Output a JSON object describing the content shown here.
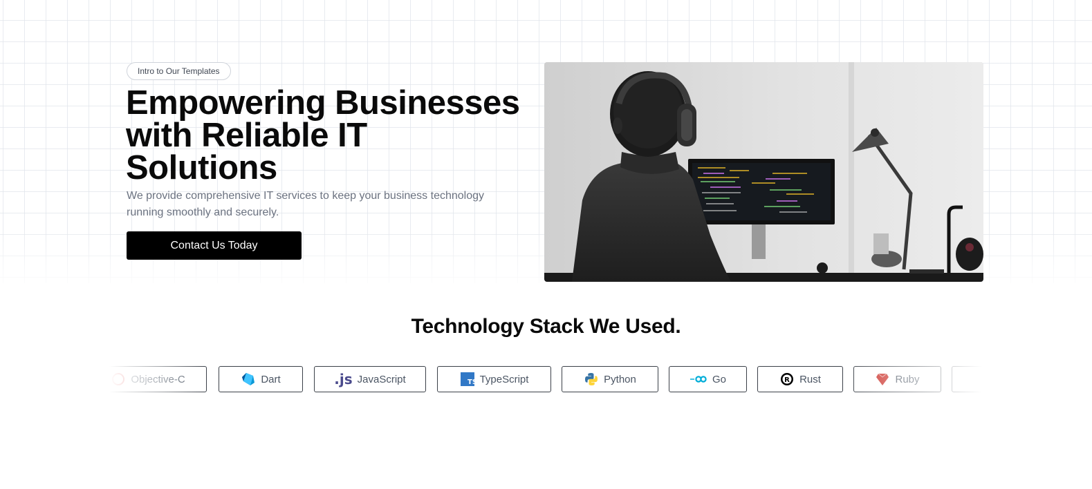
{
  "hero": {
    "badge": "Intro to Our Templates",
    "headline_lines": [
      "Empowering Businesses",
      "with Reliable IT",
      "Solutions"
    ],
    "subtext": "We provide comprehensive IT services to keep your business technology running smoothly and securely.",
    "cta_label": "Contact Us Today"
  },
  "tech": {
    "title": "Technology Stack We Used.",
    "items": [
      {
        "label": "Objective-C",
        "icon": "objective-c-icon"
      },
      {
        "label": "Dart",
        "icon": "dart-icon"
      },
      {
        "label": "JavaScript",
        "icon": "javascript-icon"
      },
      {
        "label": "TypeScript",
        "icon": "typescript-icon"
      },
      {
        "label": "Python",
        "icon": "python-icon"
      },
      {
        "label": "Go",
        "icon": "go-icon"
      },
      {
        "label": "Rust",
        "icon": "rust-icon"
      },
      {
        "label": "Ruby",
        "icon": "ruby-icon"
      }
    ]
  },
  "colors": {
    "primary": "#000000",
    "text": "#0a0a0a",
    "muted": "#6b7280",
    "dart": "#0c99d6",
    "javascript": "#323330",
    "typescript": "#3178c6",
    "go": "#00add8",
    "ruby": "#cc342d"
  }
}
